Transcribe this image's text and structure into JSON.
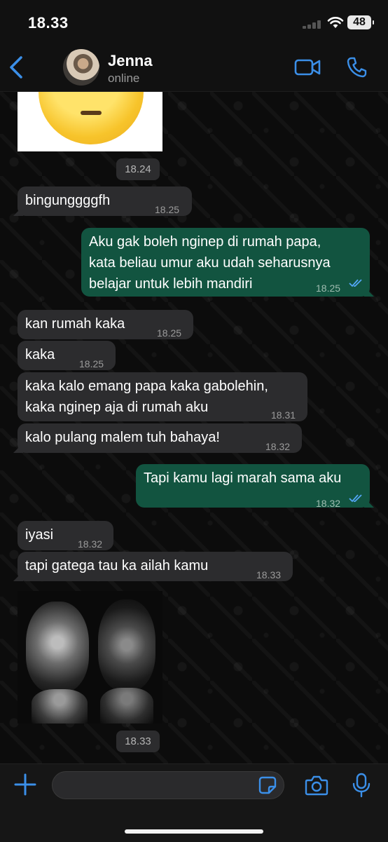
{
  "status_bar": {
    "time": "18.33",
    "battery": "48"
  },
  "header": {
    "name": "Jenna",
    "status": "online"
  },
  "messages": [
    {
      "type": "in",
      "text": "bingunggggfh",
      "time": "18.25"
    },
    {
      "type": "out",
      "lines": [
        "Aku gak boleh nginep di rumah papa,",
        "kata beliau umur aku udah seharusnya",
        "belajar untuk lebih mandiri"
      ],
      "time": "18.25"
    },
    {
      "type": "in",
      "text": "kan rumah kaka",
      "time": "18.25"
    },
    {
      "type": "in",
      "text": "kaka",
      "time": "18.25"
    },
    {
      "type": "in",
      "lines": [
        "kaka kalo emang papa kaka gabolehin,",
        "kaka nginep aja di rumah aku"
      ],
      "time": "18.31"
    },
    {
      "type": "in",
      "text": "kalo pulang malem tuh bahaya!",
      "time": "18.32"
    },
    {
      "type": "out",
      "text": "Tapi kamu lagi marah sama aku",
      "time": "18.32"
    },
    {
      "type": "in",
      "text": "iyasi",
      "time": "18.32"
    },
    {
      "type": "in",
      "text": "tapi gatega tau ka ailah kamu",
      "time": "18.33"
    }
  ],
  "image_times": {
    "first": "18.24",
    "second": "18.33"
  },
  "input": {
    "placeholder": ""
  },
  "colors": {
    "accent": "#3b8fe8",
    "outgoing": "#125440",
    "incoming": "#2c2c2e",
    "read_tick": "#53a6f5"
  }
}
